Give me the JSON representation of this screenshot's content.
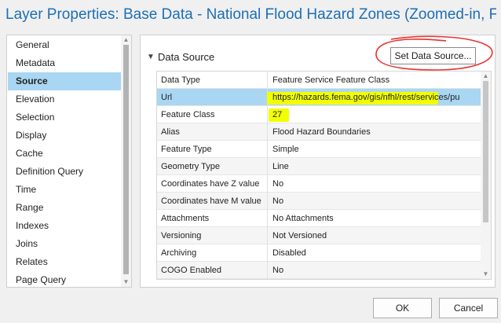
{
  "window": {
    "title": "Layer Properties: Base Data - National Flood Hazard Zones (Zoomed-in, F..."
  },
  "nav": {
    "items": [
      {
        "label": "General"
      },
      {
        "label": "Metadata"
      },
      {
        "label": "Source",
        "selected": true
      },
      {
        "label": "Elevation"
      },
      {
        "label": "Selection"
      },
      {
        "label": "Display"
      },
      {
        "label": "Cache"
      },
      {
        "label": "Definition Query"
      },
      {
        "label": "Time"
      },
      {
        "label": "Range"
      },
      {
        "label": "Indexes"
      },
      {
        "label": "Joins"
      },
      {
        "label": "Relates"
      },
      {
        "label": "Page Query"
      }
    ]
  },
  "source": {
    "section_label": "Data Source",
    "set_data_source_label": "Set Data Source...",
    "rows": [
      {
        "key": "Data Type",
        "value": "Feature Service Feature Class"
      },
      {
        "key": "Url",
        "value": "https://hazards.fema.gov/gis/nfhl/rest/services/pu"
      },
      {
        "key": "Feature Class",
        "value": "27"
      },
      {
        "key": "Alias",
        "value": "Flood Hazard Boundaries"
      },
      {
        "key": "Feature Type",
        "value": "Simple"
      },
      {
        "key": "Geometry Type",
        "value": "Line"
      },
      {
        "key": "Coordinates have Z value",
        "value": "No"
      },
      {
        "key": "Coordinates have M value",
        "value": "No"
      },
      {
        "key": "Attachments",
        "value": "No Attachments"
      },
      {
        "key": "Versioning",
        "value": "Not Versioned"
      },
      {
        "key": "Archiving",
        "value": "Disabled"
      },
      {
        "key": "COGO Enabled",
        "value": "No"
      }
    ]
  },
  "buttons": {
    "ok": "OK",
    "cancel": "Cancel"
  },
  "colors": {
    "title": "#1d6fb5",
    "selection": "#a9d6f2",
    "highlighter": "#f1ff00",
    "annotation": "#e8312f"
  },
  "icons": {
    "section_toggle": "chevron-down-icon",
    "scroll_up": "triangle-up-icon",
    "scroll_down": "triangle-down-icon"
  }
}
